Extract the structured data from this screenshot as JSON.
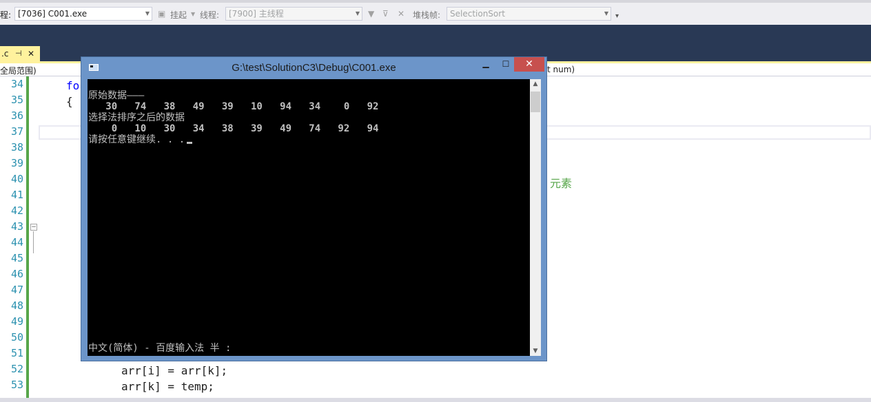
{
  "toolbar": {
    "process_label": "程:",
    "process_value": "[7036] C001.exe",
    "suspend_label": "挂起",
    "thread_label": "线程:",
    "thread_value": "[7900] 主线程",
    "stackframe_label": "堆栈帧:",
    "stackframe_value": "SelectionSort"
  },
  "tab": {
    "file_label": ".c",
    "pin_icon": "pin-icon",
    "close_icon": "close-icon"
  },
  "nav": {
    "scope_label": "全局范围)",
    "member_label": "t num)"
  },
  "editor": {
    "line_numbers": [
      "34",
      "35",
      "36",
      "37",
      "38",
      "39",
      "40",
      "41",
      "42",
      "43",
      "44",
      "45",
      "46",
      "47",
      "48",
      "49",
      "50",
      "51",
      "52",
      "53"
    ],
    "code_fo": "fo",
    "code_brace": "{",
    "code_comment": "元素",
    "code_line52": "arr[i] = arr[k];",
    "code_line53": "arr[k] = temp;"
  },
  "console": {
    "title": "G:\\test\\SolutionC3\\Debug\\C001.exe",
    "lines": [
      "原始数据———",
      "   30   74   38   49   39   10   94   34    0   92",
      "选择法排序之后的数据",
      "    0   10   30   34   38   39   49   74   92   94",
      "请按任意键继续. . ."
    ],
    "ime_status": "中文(简体) - 百度输入法 半 :",
    "minimize_symbol": "▁",
    "maximize_symbol": "☐",
    "close_symbol": "✕"
  },
  "colors": {
    "line_number": "#2b91af",
    "keyword": "#0000ff",
    "comment": "#57a64a",
    "console_bg": "#000000",
    "titlebar": "#6c95c9",
    "close_button": "#c7504e"
  }
}
